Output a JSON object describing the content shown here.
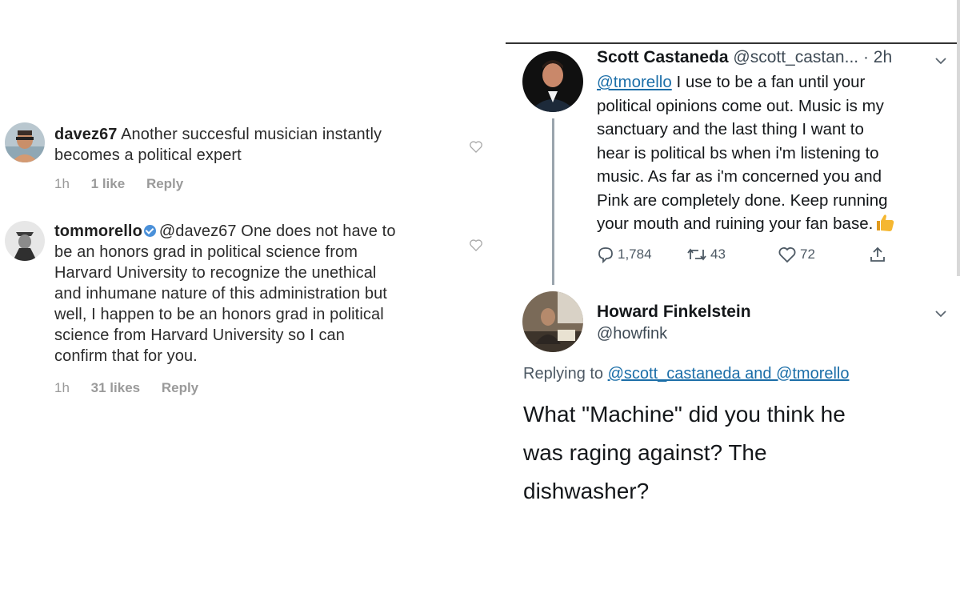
{
  "instagram": {
    "comments": [
      {
        "username": "davez67",
        "verified": false,
        "text": "Another succesful musician instantly becomes a political expert",
        "line1": "Another succesful musician instantly",
        "line2": "becomes a political expert",
        "time": "1h",
        "likes": "1 like",
        "reply_label": "Reply",
        "like_icon": "heart-outline-icon"
      },
      {
        "username": "tommorello",
        "verified": true,
        "mention": "@davez67",
        "line1": "One does not have to",
        "line2": "be an honors grad in political science from",
        "line3": "Harvard University to recognize the unethical",
        "line4": "and inhumane nature of this administration but",
        "line5": "well, I happen to be an honors grad in political",
        "line6": "science from Harvard University so I can",
        "line7": "confirm that for you.",
        "time": "1h",
        "likes": "31 likes",
        "reply_label": "Reply",
        "like_icon": "heart-outline-icon"
      }
    ]
  },
  "twitter": {
    "tweet": {
      "name": "Scott Castaneda",
      "handle": "@scott_castan...",
      "time": "· 2h",
      "mention": "@tmorello",
      "line1": "I use to be a fan until your",
      "line2": "political opinions come out. Music is my",
      "line3": "sanctuary and the last thing I want to",
      "line4": "hear is political bs when i'm listening to",
      "line5": "music. As far as i'm concerned you and",
      "line6": "Pink are completely done. Keep running",
      "line7": "your mouth and ruining your fan base.",
      "emoji": "thumbs-up-icon",
      "replies": "1,784",
      "retweets": "43",
      "likes": "72"
    },
    "reply": {
      "name": "Howard Finkelstein",
      "handle": "@howfink",
      "replying_prefix": "Replying to",
      "replying_to": "@scott_castaneda and @tmorello",
      "line1": "What \"Machine\" did you think he",
      "line2": "was raging against? The",
      "line3": "dishwasher?"
    }
  },
  "colors": {
    "instagram_text": "#2b2b2b",
    "instagram_meta": "#9a9a9a",
    "twitter_link": "#1b6ea8",
    "twitter_text": "#14171a",
    "verified_badge": "#4a90d9",
    "thumbs_up": "#f2b233"
  }
}
